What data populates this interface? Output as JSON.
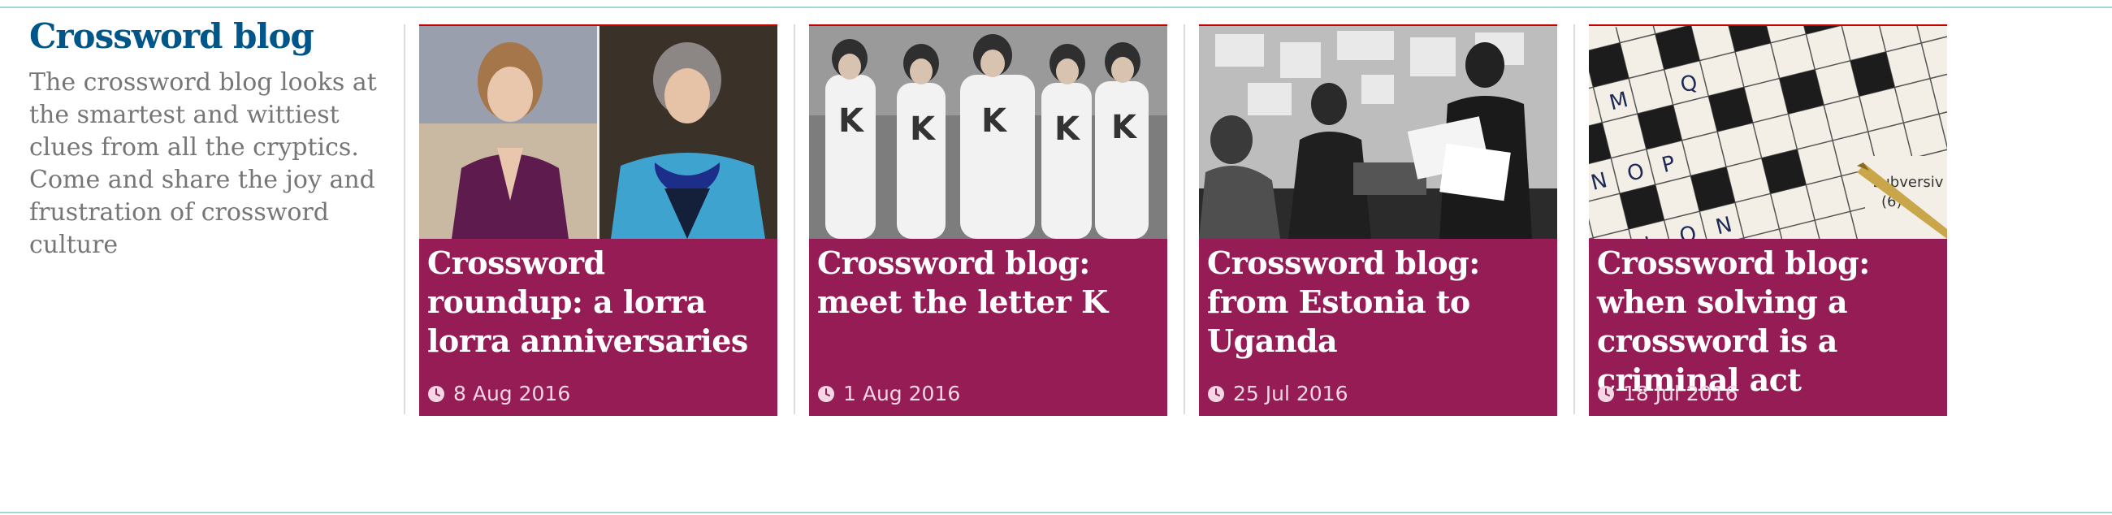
{
  "container": {
    "title": "Crossword blog",
    "description": "The crossword blog looks at the smartest and wittiest clues from all the cryptics. Come and share the joy and frustration of crossword culture"
  },
  "cards": [
    {
      "headline": "Crossword roundup: a lorra lorra anniversaries",
      "date": "8 Aug 2016",
      "image_icon": "photo-two-politicians"
    },
    {
      "headline": "Crossword blog: meet the letter K",
      "date": "1 Aug 2016",
      "image_icon": "photo-band-in-k-shirts"
    },
    {
      "headline": "Crossword blog: from Estonia to Uganda",
      "date": "25 Jul 2016",
      "image_icon": "photo-people-in-office"
    },
    {
      "headline": "Crossword blog: when solving a crossword is a criminal act",
      "date": "18 Jul 2016",
      "image_icon": "photo-crossword-grid-with-pen"
    }
  ],
  "colors": {
    "card_background": "#951c55",
    "title_color": "#005689",
    "rule_color": "#9fd9dc",
    "date_color": "#f4d6e4"
  }
}
